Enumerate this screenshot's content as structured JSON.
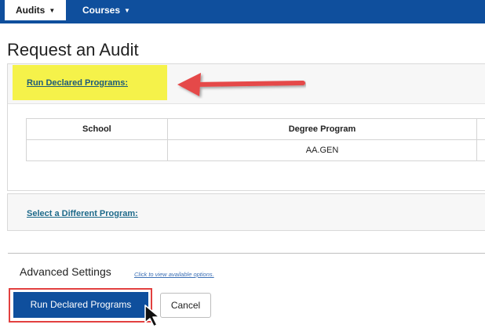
{
  "nav": {
    "audits_label": "Audits",
    "courses_label": "Courses"
  },
  "page_title": "Request an Audit",
  "declared": {
    "link_label": "Run Declared Programs:",
    "table": {
      "headers": [
        "School",
        "Degree Program"
      ],
      "rows": [
        {
          "school": "",
          "degree_program": "AA.GEN"
        }
      ]
    }
  },
  "different_program": {
    "link_label": "Select a Different Program:"
  },
  "advanced": {
    "title": "Advanced Settings",
    "link_label": "Click to view available options."
  },
  "actions": {
    "run_label": "Run Declared Programs",
    "cancel_label": "Cancel"
  },
  "colors": {
    "brand": "#0f4f9d",
    "highlight": "#f5f24a",
    "annotation_red": "#e2403f"
  },
  "icons": {
    "nav_caret": "caret-down-icon",
    "annotation_arrow": "red-arrow-icon",
    "mouse_cursor": "mouse-pointer-icon"
  }
}
